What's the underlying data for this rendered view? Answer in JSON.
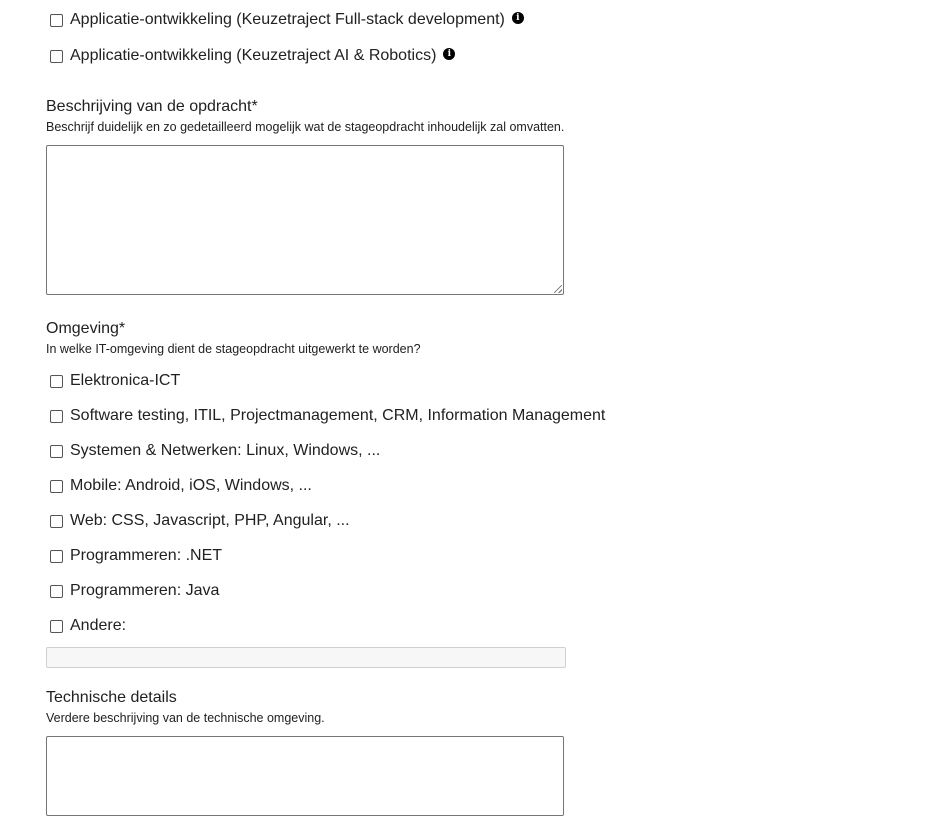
{
  "traject_options": [
    {
      "label": "Applicatie-ontwikkeling (Keuzetraject Full-stack development)",
      "checked": false,
      "icon": "info-icon"
    },
    {
      "label": "Applicatie-ontwikkeling (Keuzetraject AI & Robotics)",
      "checked": false,
      "icon": "info-icon"
    }
  ],
  "info_glyph": "i",
  "description": {
    "title": "Beschrijving van de opdracht*",
    "help": "Beschrijf duidelijk en zo gedetailleerd mogelijk wat de stageopdracht inhoudelijk zal omvatten.",
    "value": ""
  },
  "environment": {
    "title": "Omgeving*",
    "help": "In welke IT-omgeving dient de stageopdracht uitgewerkt te worden?",
    "options": [
      {
        "label": "Elektronica-ICT",
        "checked": false
      },
      {
        "label": "Software testing, ITIL, Projectmanagement, CRM, Information Management",
        "checked": false
      },
      {
        "label": "Systemen & Netwerken: Linux, Windows, ...",
        "checked": false
      },
      {
        "label": "Mobile: Android, iOS, Windows, ...",
        "checked": false
      },
      {
        "label": "Web: CSS, Javascript, PHP, Angular, ...",
        "checked": false
      },
      {
        "label": "Programmeren: .NET",
        "checked": false
      },
      {
        "label": "Programmeren: Java",
        "checked": false
      },
      {
        "label": "Andere:",
        "checked": false
      }
    ],
    "other_value": ""
  },
  "technical": {
    "title": "Technische details",
    "help": "Verdere beschrijving van de technische omgeving.",
    "value": ""
  }
}
